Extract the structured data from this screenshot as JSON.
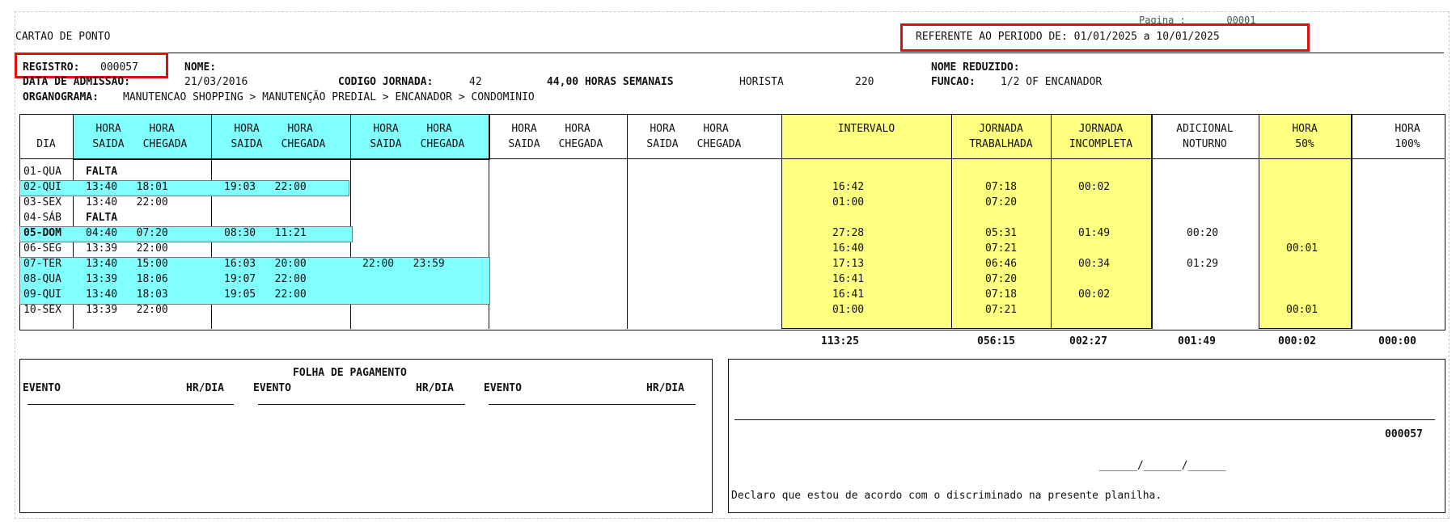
{
  "header": {
    "pagina": "Pagina :       00001",
    "title": "CARTAO DE PONTO",
    "periodo": "REFERENTE AO PERIODO DE: 01/01/2025 a 10/01/2025"
  },
  "info": {
    "registro_label": "REGISTRO:",
    "registro_value": "000057",
    "nome_label": "NOME:",
    "nome_reduzido_label": "NOME REDUZIDO:",
    "admissao_label": "DATA DE ADMISSAO:",
    "admissao_value": "21/03/2016",
    "codigo_label": "CODIGO JORNADA:",
    "codigo_value": "42",
    "horas_semanais": "44,00 HORAS SEMANAIS",
    "horista": "HORISTA",
    "horista_value": "220",
    "funcao_label": "FUNCAO:",
    "funcao_value": "1/2 OF ENCANADOR",
    "organograma_label": "ORGANOGRAMA:",
    "organograma_value": "MANUTENCAO SHOPPING > MANUTENÇÃO PREDIAL > ENCANADOR > CONDOMINIO"
  },
  "table": {
    "col_dia": "DIA",
    "hora_saida": "HORA SAIDA",
    "hora_chegada": "HORA CHEGADA",
    "intervalo": "INTERVALO",
    "jornada_trab_1": "JORNADA",
    "jornada_trab_2": "TRABALHADA",
    "jornada_inc_1": "JORNADA",
    "jornada_inc_2": "INCOMPLETA",
    "adicional_1": "ADICIONAL",
    "adicional_2": "NOTURNO",
    "hora50_1": "HORA",
    "hora50_2": "50%",
    "hora100_1": "HORA",
    "hora100_2": "100%",
    "rows": [
      {
        "dia": "01-QUA",
        "p1": "FALTA",
        "p2": "",
        "p3": "",
        "intervalo": "",
        "trab": "",
        "inc": "",
        "not": "",
        "h50": ""
      },
      {
        "dia": "02-QUI",
        "p1": "13:40   18:01",
        "p2": "19:03   22:00",
        "p3": "",
        "intervalo": "16:42",
        "trab": "07:18",
        "inc": "00:02",
        "not": "",
        "h50": ""
      },
      {
        "dia": "03-SEX",
        "p1": "13:40   22:00",
        "p2": "",
        "p3": "",
        "intervalo": "01:00",
        "trab": "07:20",
        "inc": "",
        "not": "",
        "h50": ""
      },
      {
        "dia": "04-SÁB",
        "p1": "FALTA",
        "p2": "",
        "p3": "",
        "intervalo": "",
        "trab": "",
        "inc": "",
        "not": "",
        "h50": ""
      },
      {
        "dia": "05-DOM",
        "p1": "04:40   07:20",
        "p2": "08:30   11:21",
        "p3": "",
        "intervalo": "27:28",
        "trab": "05:31",
        "inc": "01:49",
        "not": "00:20",
        "h50": ""
      },
      {
        "dia": "06-SEG",
        "p1": "13:39   22:00",
        "p2": "",
        "p3": "",
        "intervalo": "16:40",
        "trab": "07:21",
        "inc": "",
        "not": "",
        "h50": "00:01"
      },
      {
        "dia": "07-TER",
        "p1": "13:40   15:00",
        "p2": "16:03   20:00",
        "p3": "22:00   23:59",
        "intervalo": "17:13",
        "trab": "06:46",
        "inc": "00:34",
        "not": "01:29",
        "h50": ""
      },
      {
        "dia": "08-QUA",
        "p1": "13:39   18:06",
        "p2": "19:07   22:00",
        "p3": "",
        "intervalo": "16:41",
        "trab": "07:20",
        "inc": "",
        "not": "",
        "h50": ""
      },
      {
        "dia": "09-QUI",
        "p1": "13:40   18:03",
        "p2": "19:05   22:00",
        "p3": "",
        "intervalo": "16:41",
        "trab": "07:18",
        "inc": "00:02",
        "not": "",
        "h50": ""
      },
      {
        "dia": "10-SEX",
        "p1": "13:39   22:00",
        "p2": "",
        "p3": "",
        "intervalo": "01:00",
        "trab": "07:21",
        "inc": "",
        "not": "",
        "h50": "00:01"
      }
    ],
    "totals": {
      "intervalo": "113:25",
      "trab": "056:15",
      "inc": "002:27",
      "not": "001:49",
      "h50": "000:02",
      "h100": "000:00"
    }
  },
  "folha": {
    "title": "FOLHA DE PAGAMENTO",
    "evento": "EVENTO",
    "hrdia": "HR/DIA"
  },
  "assinatura": {
    "registro": "000057",
    "data": "______/______/______",
    "declaro": "Declaro que estou de acordo com o discriminado na presente planilha."
  }
}
